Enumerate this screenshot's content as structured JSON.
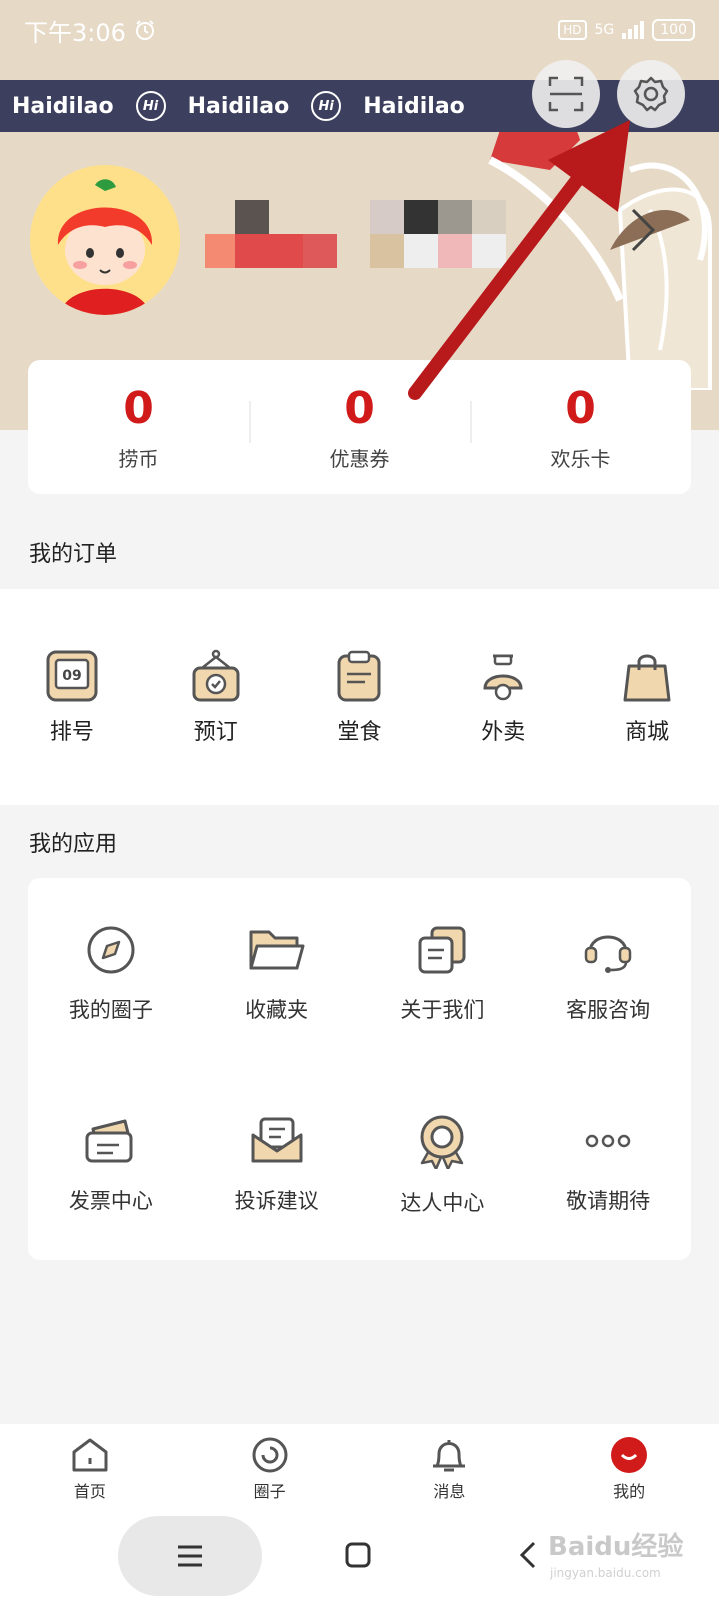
{
  "status": {
    "time": "下午3:06",
    "network": "5G",
    "battery": "100"
  },
  "brand": {
    "name": "Haidilao",
    "mark": "Hi"
  },
  "header_actions": [
    "scan-icon",
    "settings-icon"
  ],
  "assets": [
    {
      "value": "0",
      "label": "捞币"
    },
    {
      "value": "0",
      "label": "优惠券"
    },
    {
      "value": "0",
      "label": "欢乐卡"
    }
  ],
  "orders": {
    "title": "我的订单",
    "items": [
      {
        "label": "排号",
        "icon": "queue-number-icon",
        "icon_text": "09"
      },
      {
        "label": "预订",
        "icon": "reservation-icon"
      },
      {
        "label": "堂食",
        "icon": "dine-in-icon"
      },
      {
        "label": "外卖",
        "icon": "delivery-icon"
      },
      {
        "label": "商城",
        "icon": "shopping-bag-icon"
      }
    ]
  },
  "apps": {
    "title": "我的应用",
    "items": [
      {
        "label": "我的圈子",
        "icon": "compass-icon"
      },
      {
        "label": "收藏夹",
        "icon": "folder-icon"
      },
      {
        "label": "关于我们",
        "icon": "about-icon"
      },
      {
        "label": "客服咨询",
        "icon": "headset-icon"
      },
      {
        "label": "发票中心",
        "icon": "invoice-icon"
      },
      {
        "label": "投诉建议",
        "icon": "envelope-icon"
      },
      {
        "label": "达人中心",
        "icon": "medal-icon"
      },
      {
        "label": "敬请期待",
        "icon": "more-icon"
      }
    ]
  },
  "tabs": [
    {
      "label": "首页",
      "icon": "home-icon"
    },
    {
      "label": "圈子",
      "icon": "circle-icon"
    },
    {
      "label": "消息",
      "icon": "bell-icon"
    },
    {
      "label": "我的",
      "icon": "profile-icon",
      "active": true
    }
  ],
  "watermark": {
    "text": "Baidu经验",
    "sub": "jingyan.baidu.com"
  },
  "colors": {
    "accent": "#d11a1a",
    "band": "#3c3f5d",
    "hero": "#e6d9c6",
    "icon_fill": "#f1d7ad",
    "icon_stroke": "#555555"
  }
}
